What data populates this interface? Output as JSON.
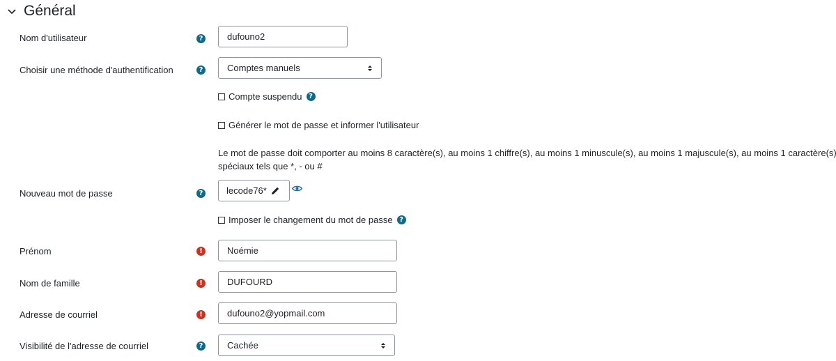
{
  "section": {
    "title": "Général",
    "icon": "chevron-down-icon"
  },
  "fields": {
    "username": {
      "label": "Nom d'utilisateur",
      "value": "dufouno2"
    },
    "auth": {
      "label": "Choisir une méthode d'authentification",
      "value": "Comptes manuels"
    },
    "suspended": {
      "label": "Compte suspendu"
    },
    "generate": {
      "label": "Générer le mot de passe et informer l'utilisateur"
    },
    "policy": {
      "text": "Le mot de passe doit comporter au moins 8 caractère(s), au moins 1 chiffre(s), au moins 1 minuscule(s), au moins 1 majuscule(s), au moins 1 caractère(s) spéciaux tels que *, - ou #"
    },
    "new_password": {
      "label": "Nouveau mot de passe",
      "value": "lecode76*"
    },
    "force_change": {
      "label": "Imposer le changement du mot de passe"
    },
    "firstname": {
      "label": "Prénom",
      "value": "Noémie"
    },
    "lastname": {
      "label": "Nom de famille",
      "value": "DUFOURD"
    },
    "email": {
      "label": "Adresse de courriel",
      "value": "dufouno2@yopmail.com"
    },
    "email_visibility": {
      "label": "Visibilité de l'adresse de courriel",
      "value": "Cachée"
    }
  },
  "colors": {
    "help": "#11698a",
    "required": "#ca3120",
    "border": "#8f959e",
    "link": "#0f6cbf"
  }
}
